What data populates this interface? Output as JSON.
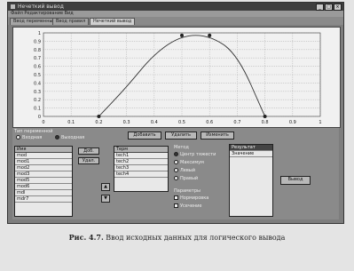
{
  "window": {
    "title": "Нечеткий вывод",
    "menu": "Файл  Редактирование  Вид",
    "tabs": [
      "Ввод переменных",
      "Ввод правил",
      "Нечеткий вывод"
    ],
    "active_tab": 2
  },
  "chart_data": {
    "type": "line",
    "x": [
      0.2,
      0.3,
      0.4,
      0.5,
      0.6,
      0.7,
      0.8
    ],
    "y": [
      0.0,
      0.35,
      0.75,
      0.97,
      0.97,
      0.75,
      0.0
    ],
    "markers_x": [
      0.2,
      0.5,
      0.6,
      0.8
    ],
    "markers_y": [
      0.0,
      0.97,
      0.97,
      0.0
    ],
    "xlim": [
      0,
      1
    ],
    "ylim": [
      0,
      1
    ],
    "x_ticks": [
      "0",
      "0.1",
      "0.2",
      "0.3",
      "0.4",
      "0.5",
      "0.6",
      "0.7",
      "0.8",
      "0.9",
      "1"
    ],
    "y_ticks": [
      "0",
      "0.1",
      "0.2",
      "0.3",
      "0.4",
      "0.5",
      "0.6",
      "0.7",
      "0.8",
      "0.9",
      "1"
    ],
    "grid": true,
    "line_color": "#333333"
  },
  "controls": {
    "group_label": "Тип переменной",
    "radio_1": "Входная",
    "radio_2": "Выходная",
    "btn_add": "Добавить",
    "btn_delete": "Удалить",
    "btn_edit": "Изменить",
    "btn_add_left": "Доб.",
    "btn_del_left": "Удал.",
    "btn_arrow_up": "▲",
    "btn_arrow_down": "▼",
    "calc_button": "Вывод",
    "method_label": "Метод",
    "methods": [
      "Центр тяжести",
      "Максимум",
      "Левый",
      "Правый"
    ],
    "options_label": "Параметры",
    "options": [
      "Нормировка",
      "Усечение"
    ]
  },
  "list_vars": {
    "header": "Имя",
    "items": [
      "mod",
      "mod1",
      "mod2",
      "mod3",
      "mod5",
      "mod6",
      "mdl",
      "mdr7"
    ]
  },
  "list_terms": {
    "header": "Терм",
    "items": [
      "tech1",
      "tech2",
      "tech3",
      "tech4"
    ]
  },
  "list_result": {
    "items": [
      "Результат",
      "Значение"
    ],
    "selected": 0
  },
  "caption": {
    "label": "Рис. 4.7.",
    "text": "Ввод исходных данных для логического вывода"
  }
}
